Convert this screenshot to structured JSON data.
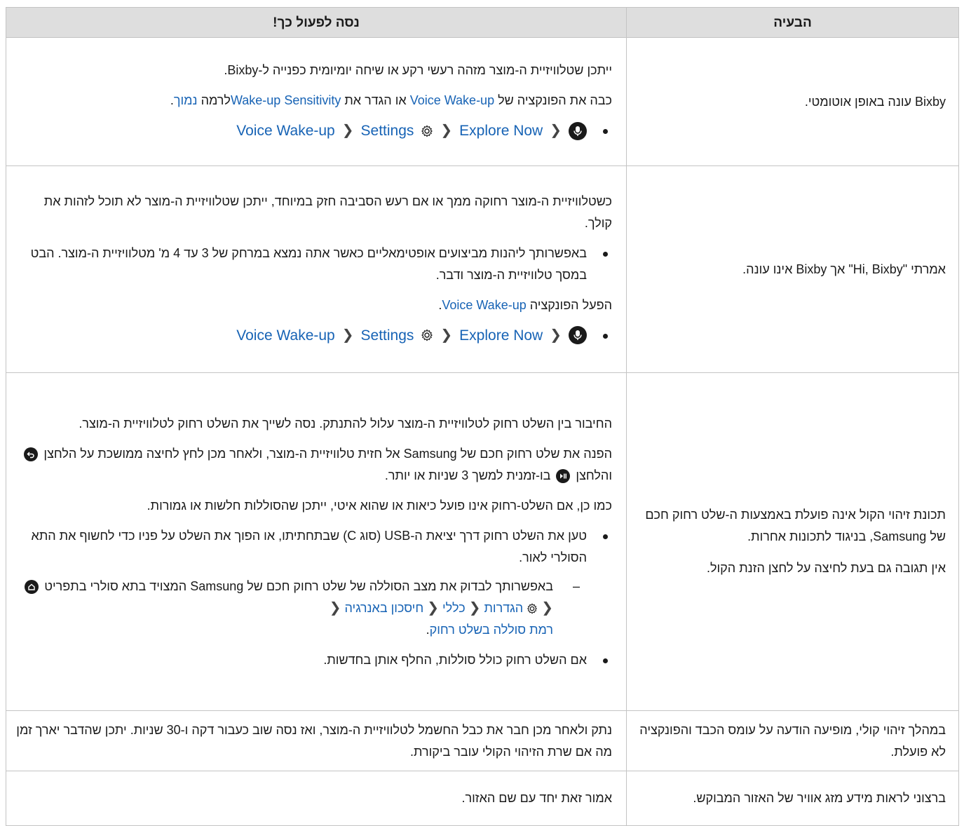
{
  "header": {
    "problem": "הבעיה",
    "solution": "נסה לפעול כך!"
  },
  "rows": [
    {
      "problem": "Bixby עונה באופן אוטומטי.",
      "p1": "ייתכן שטלוויזיית ה-מוצר מזהה רעשי רקע או שיחה יומיומית כפנייה ל-Bixby.",
      "p2_a": "כבה את הפונקציה של ",
      "p2_link1": "Voice Wake-up",
      "p2_b": " או הגדר את ",
      "p2_link2": "Wake-up Sensitivity",
      "p2_c": "לרמה ",
      "p2_link3": "נמוך",
      "p2_d": ".",
      "path": [
        "Explore Now",
        "Settings",
        "Voice Wake-up"
      ]
    },
    {
      "problem": "אמרתי \"Hi, Bixby\" אך Bixby אינו עונה.",
      "p1": "כשטלוויזיית ה-מוצר רחוקה ממך או אם רעש הסביבה חזק במיוחד, ייתכן שטלוויזיית ה-מוצר לא תוכל לזהות את קולך.",
      "bullet1": "באפשרותך ליהנות מביצועים אופטימאליים כאשר אתה נמצא במרחק של 3 עד 4 מ' מטלוויזיית ה-מוצר. הבט במסך טלוויזיית ה-מוצר ודבר.",
      "p2_a": "הפעל הפונקציה ",
      "p2_link": "Voice Wake-up",
      "p2_b": ".",
      "path": [
        "Explore Now",
        "Settings",
        "Voice Wake-up"
      ]
    },
    {
      "problem1": "תכונת זיהוי הקול אינה פועלת באמצעות ה-שלט רחוק חכם של Samsung, בניגוד לתכונות אחרות.",
      "problem2": "אין תגובה גם בעת לחיצה על לחצן הזנת הקול.",
      "p1": "החיבור בין השלט רחוק לטלוויזיית ה-מוצר עלול להתנתק. נסה לשייך את השלט רחוק לטלוויזיית ה-מוצר.",
      "p2_a": "הפנה את שלט רחוק חכם של Samsung אל חזית טלוויזיית ה-מוצר, ולאחר מכן לחץ לחיצה ממושכת על הלחצן ",
      "p2_b": " והלחצן ",
      "p2_c": " בו-זמנית למשך 3 שניות או יותר.",
      "p3": "כמו כן, אם השלט-רחוק אינו פועל כיאות או שהוא איטי, ייתכן שהסוללות חלשות או גמורות.",
      "bullet1": "טען את השלט רחוק דרך יציאת ה-USB (סוג C) שבתחתיתו, או הפוך את השלט על פניו כדי לחשוף את התא הסולרי לאור.",
      "dash_a": "באפשרותך לבדוק את מצב הסוללה של שלט רחוק חכם של Samsung המצויד בתא סולרי בתפריט ",
      "dash_path": [
        "הגדרות",
        "כללי",
        "חיסכון באנרגיה",
        "רמת סוללה בשלט רחוק"
      ],
      "dash_end": ".",
      "bullet2": "אם השלט רחוק כולל סוללות, החלף אותן בחדשות."
    },
    {
      "problem": "במהלך זיהוי קולי, מופיעה הודעה על עומס הכבד והפונקציה לא פועלת.",
      "p1": "נתק ולאחר מכן חבר את כבל החשמל לטלוויזיית ה-מוצר, ואז נסה שוב כעבור דקה ו-30 שניות. יתכן שהדבר יארך זמן מה אם שרת הזיהוי הקולי עובר ביקורת."
    },
    {
      "problem": "ברצוני לראות מידע מזג אוויר של האזור המבוקש.",
      "p1": "אמור זאת יחד עם שם האזור."
    }
  ]
}
